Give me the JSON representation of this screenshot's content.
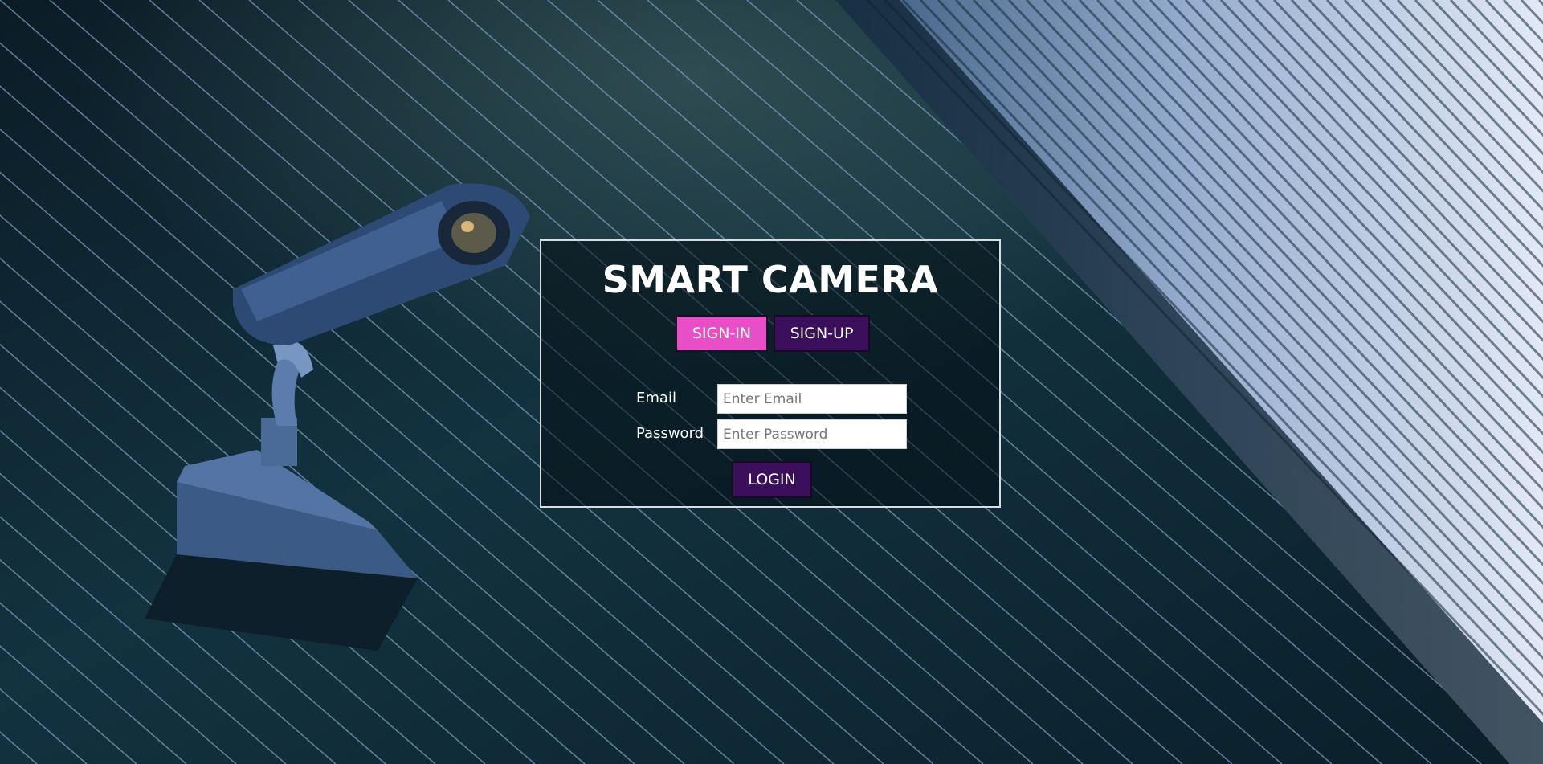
{
  "app": {
    "title": "SMART CAMERA"
  },
  "tabs": {
    "signin_label": "SIGN-IN",
    "signup_label": "SIGN-UP",
    "active": "signin"
  },
  "form": {
    "email_label": "Email",
    "email_placeholder": "Enter Email",
    "email_value": "",
    "password_label": "Password",
    "password_placeholder": "Enter Password",
    "password_value": "",
    "login_label": "LOGIN"
  },
  "colors": {
    "signin_tab": "#e84fc7",
    "signup_tab": "#3b0f5c",
    "login_button": "#3b0f5c",
    "panel_border": "#d8dde2"
  },
  "background": {
    "icon": "security-camera-icon"
  }
}
